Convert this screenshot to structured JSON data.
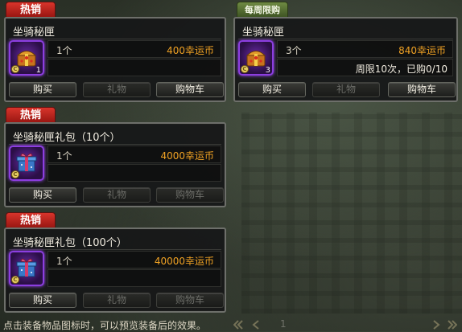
{
  "cards": [
    {
      "tag": "热销",
      "name": "坐骑秘匣",
      "qty": "1个",
      "icon_count": "1",
      "price": "400幸运币",
      "limit": "",
      "buttons": [
        "购买",
        "礼物",
        "购物车"
      ],
      "icon": "treasure-chest-icon"
    },
    {
      "tag": "每周限购",
      "name": "坐骑秘匣",
      "qty": "3个",
      "icon_count": "3",
      "price": "840幸运币",
      "limit": "周限10次，已购0/10",
      "buttons": [
        "购买",
        "礼物",
        "购物车"
      ],
      "icon": "treasure-chest-icon"
    },
    {
      "tag": "热销",
      "name": "坐骑秘匣礼包（10个）",
      "qty": "1个",
      "icon_count": "",
      "price": "4000幸运币",
      "limit": "",
      "buttons": [
        "购买",
        "礼物",
        "购物车"
      ],
      "icon": "gift-box-icon"
    },
    {
      "tag": "热销",
      "name": "坐骑秘匣礼包（100个）",
      "qty": "1个",
      "icon_count": "",
      "price": "40000幸运币",
      "limit": "",
      "buttons": [
        "购买",
        "礼物",
        "购物车"
      ],
      "icon": "gift-box-icon"
    }
  ],
  "coin_glyph": "C",
  "footer_hint": "点击装备物品图标时，可以预览装备后的效果。",
  "page_number": "1",
  "colors": {
    "hot_tag": "#c2261f",
    "weekly_tag": "#5a7236",
    "price": "#f0a224",
    "icon_border": "#8c3ee0"
  }
}
